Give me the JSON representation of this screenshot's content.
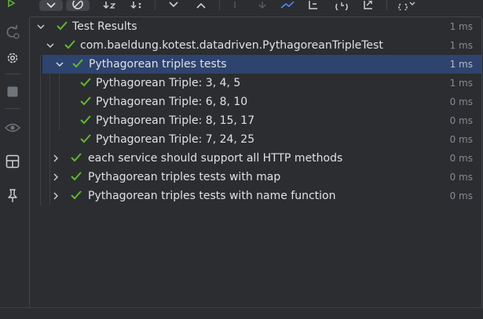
{
  "toolbar": {
    "icons": [
      "rerun-icon",
      "rerun-failed-icon",
      "settings-icon",
      "stop-icon",
      "preview-icon",
      "layout-icon",
      "pin-icon"
    ],
    "top_buttons": [
      "show-passed-icon",
      "show-ignored-icon",
      "sort-alphabetically-icon",
      "sort-duration-icon",
      "expand-all-icon",
      "collapse-all-icon",
      "previous-failed-icon",
      "next-failed-icon",
      "import-tests-icon",
      "export-tests-icon",
      "history-icon",
      "open-external-icon",
      "test-settings-icon"
    ]
  },
  "tree": {
    "root": {
      "label": "Test Results",
      "time": "1 ms"
    },
    "class_node": {
      "label": "com.baeldung.kotest.datadriven.PythagoreanTripleTest",
      "time": "1 ms"
    },
    "nodes": [
      {
        "label": "Pythagorean triples tests",
        "time": "1 ms",
        "expanded": true,
        "selected": true,
        "children": [
          {
            "label": "Pythagorean Triple: 3, 4, 5",
            "time": "1 ms"
          },
          {
            "label": "Pythagorean Triple: 6, 8, 10",
            "time": "0 ms"
          },
          {
            "label": "Pythagorean Triple: 8, 15, 17",
            "time": "0 ms"
          },
          {
            "label": "Pythagorean Triple: 7, 24, 25",
            "time": "0 ms"
          }
        ]
      },
      {
        "label": "each service should support all HTTP methods",
        "time": "0 ms",
        "expanded": false
      },
      {
        "label": "Pythagorean triples tests with map",
        "time": "0 ms",
        "expanded": false
      },
      {
        "label": "Pythagorean triples tests with name function",
        "time": "0 ms",
        "expanded": false
      }
    ]
  },
  "colors": {
    "pass": "#5fb832",
    "selection": "#2e436e",
    "background": "#2b2d30",
    "text": "#dfe1e5",
    "muted": "#868a91"
  }
}
